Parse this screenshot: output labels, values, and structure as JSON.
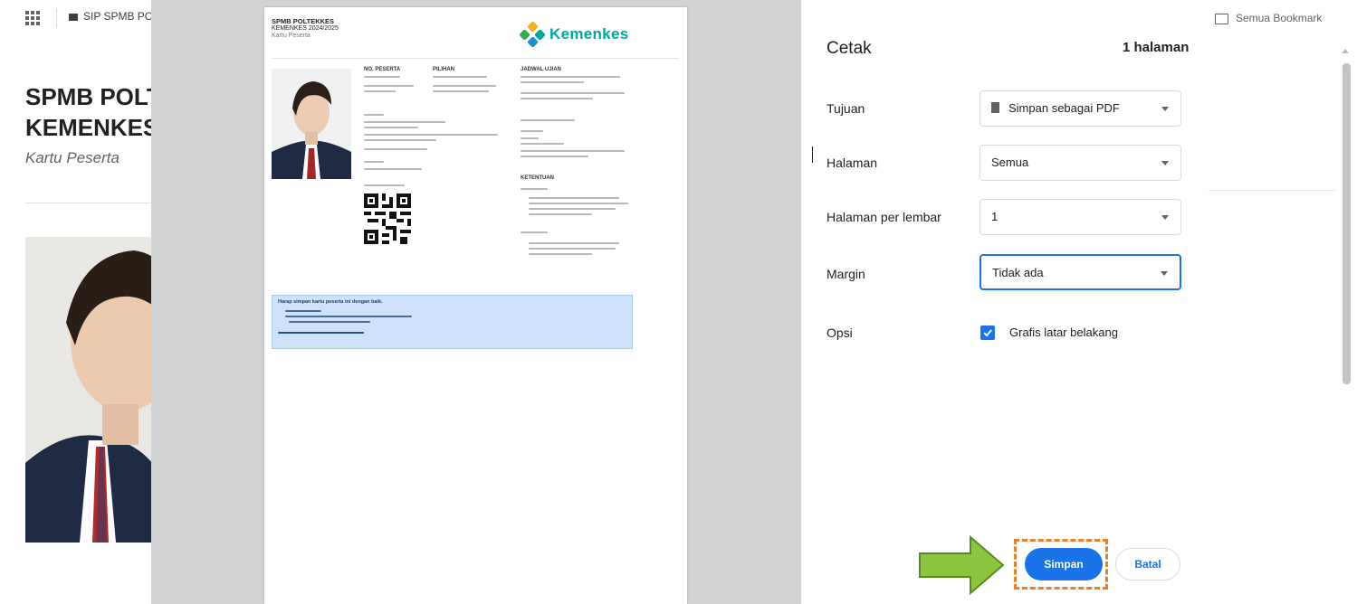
{
  "background": {
    "bookmark_label": "SIP SPMB POLTEKKES",
    "all_bookmarks": "Semua Bookmark",
    "page_title_line1": "SPMB POLTEKKES",
    "page_title_line2": "KEMENKES",
    "page_subtitle": "Kartu Peserta"
  },
  "document": {
    "header_line1": "SPMB POLTEKKES",
    "header_line2": "KEMENKES 2024/2025",
    "header_line3": "Kartu Peserta",
    "logo_text": "Kemenkes",
    "info_title": "Harap simpan kartu peserta ini dengan baik."
  },
  "dialog": {
    "title": "Cetak",
    "page_count": "1 halaman",
    "rows": [
      {
        "label": "Tujuan",
        "value": "Simpan sebagai PDF"
      },
      {
        "label": "Halaman",
        "value": "Semua"
      },
      {
        "label": "Halaman per lembar",
        "value": "1"
      },
      {
        "label": "Margin",
        "value": "Tidak ada"
      },
      {
        "label": "Opsi",
        "value": "Grafis latar belakang"
      }
    ],
    "save_label": "Simpan",
    "cancel_label": "Batal"
  },
  "colors": {
    "accent": "#1a73e8",
    "highlight": "#f07f22",
    "arrow": "#8cc63f",
    "logo_teal": "#00a7a0"
  }
}
